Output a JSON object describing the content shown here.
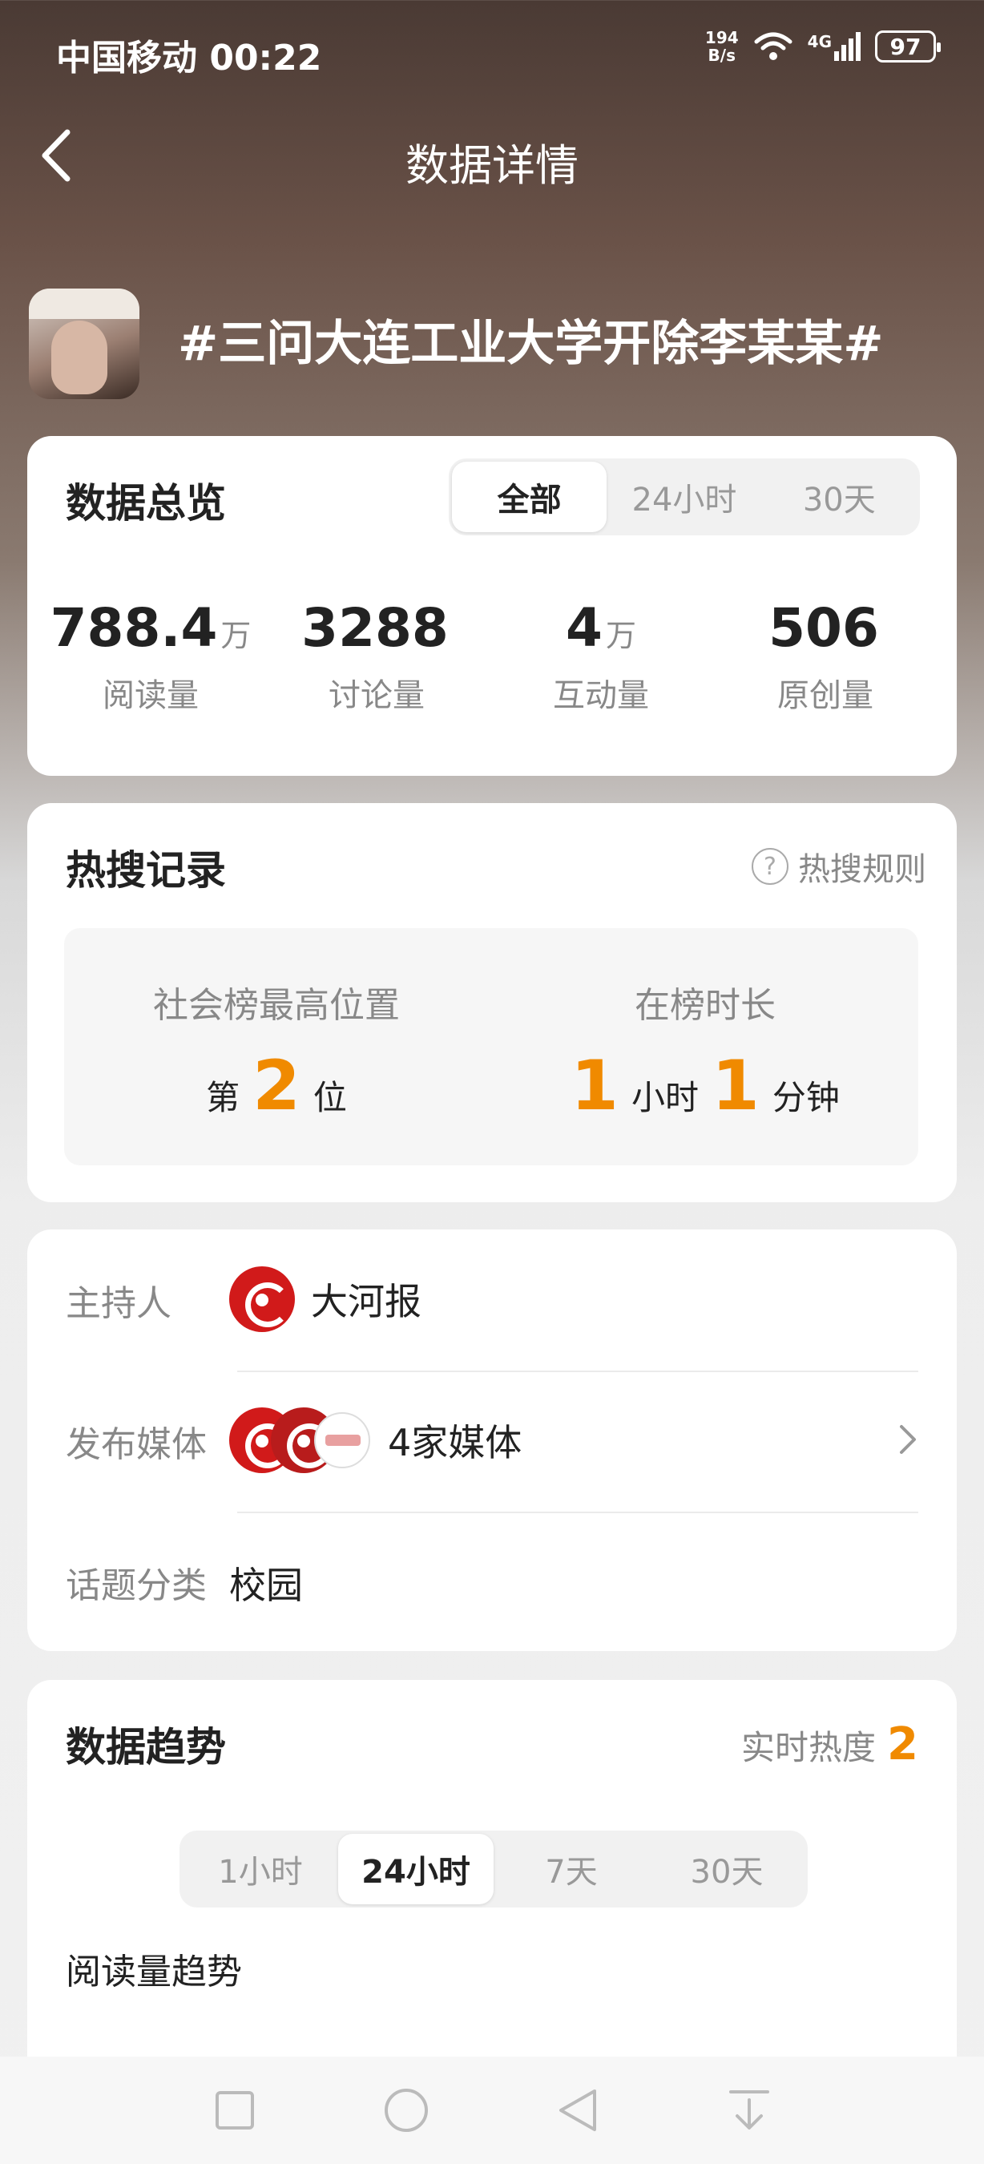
{
  "status_bar": {
    "carrier": "中国移动",
    "time": "00:22",
    "net_speed_value": "194",
    "net_speed_unit": "B/s",
    "network": "4G",
    "battery": "97"
  },
  "nav": {
    "title": "数据详情"
  },
  "topic": {
    "title": "#三问大连工业大学开除李某某#"
  },
  "overview": {
    "title": "数据总览",
    "tabs": [
      "全部",
      "24小时",
      "30天"
    ],
    "active_tab": "全部",
    "metrics": [
      {
        "value": "788.4",
        "unit": "万",
        "label": "阅读量"
      },
      {
        "value": "3288",
        "unit": "",
        "label": "讨论量"
      },
      {
        "value": "4",
        "unit": "万",
        "label": "互动量"
      },
      {
        "value": "506",
        "unit": "",
        "label": "原创量"
      }
    ]
  },
  "hot_search": {
    "title": "热搜记录",
    "rule_link": "热搜规则",
    "rank_label": "社会榜最高位置",
    "rank_prefix": "第",
    "rank_value": "2",
    "rank_suffix": "位",
    "duration_label": "在榜时长",
    "hours_value": "1",
    "hours_unit": "小时",
    "minutes_value": "1",
    "minutes_unit": "分钟"
  },
  "info": {
    "host_label": "主持人",
    "host_name": "大河报",
    "media_label": "发布媒体",
    "media_count": "4家媒体",
    "category_label": "话题分类",
    "category_value": "校园"
  },
  "trend": {
    "title": "数据趋势",
    "realtime_label": "实时热度",
    "realtime_value": "2",
    "tabs": [
      "1小时",
      "24小时",
      "7天",
      "30天"
    ],
    "active_tab": "24小时",
    "subheading": "阅读量趋势"
  },
  "colors": {
    "accent_orange": "#f08a00",
    "brand_red": "#d11a1a"
  }
}
